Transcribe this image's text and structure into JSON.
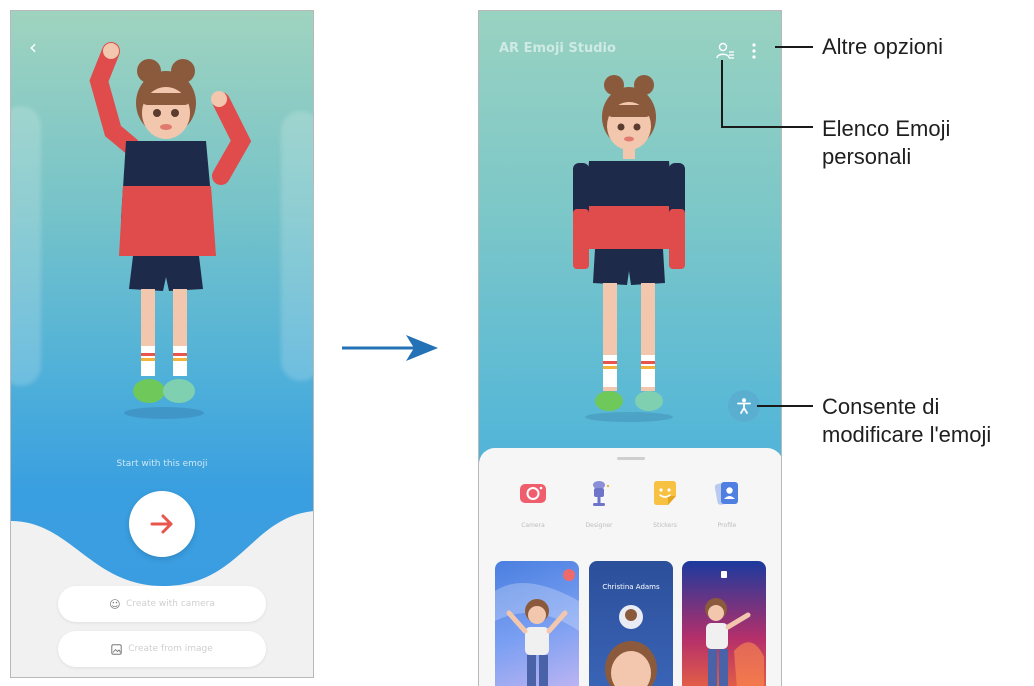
{
  "left_screen": {
    "hint": "Start with this emoji",
    "buttons": {
      "next_icon": "arrow-right-icon",
      "create_camera": "Create with camera",
      "create_image": "Create from image"
    }
  },
  "right_screen": {
    "title": "AR Emoji Studio",
    "modes": [
      {
        "label": "Camera",
        "icon": "camera-icon"
      },
      {
        "label": "Designer",
        "icon": "designer-icon"
      },
      {
        "label": "Stickers",
        "icon": "sticker-icon"
      },
      {
        "label": "Profile",
        "icon": "profile-icon"
      }
    ],
    "thumbnail_caller": "Christina Adams"
  },
  "callouts": {
    "altre_opzioni": "Altre opzioni",
    "elenco_line1": "Elenco Emoji",
    "elenco_line2": "personali",
    "consente_line1": "Consente di",
    "consente_line2": "modificare l'emoji"
  },
  "colors": {
    "accent_red": "#e8554c",
    "flow_arrow": "#2472b6",
    "edit_fab": "#5aaed0"
  }
}
